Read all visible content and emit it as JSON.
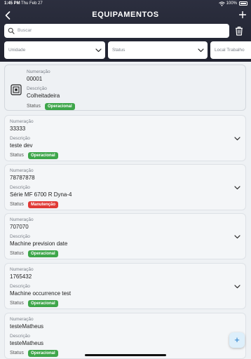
{
  "statusbar": {
    "time": "1:45 PM",
    "date": "Thu Feb 27",
    "battery": "100%"
  },
  "header": {
    "title": "EQUIPAMENTOS"
  },
  "search": {
    "placeholder": "Buscar"
  },
  "filters": {
    "unidade": "Unidade",
    "status": "Status",
    "local": "Local Trabalho"
  },
  "labels": {
    "numeracao": "Numeração",
    "descricao": "Descrição",
    "status": "Status"
  },
  "items": [
    {
      "numeracao": "00001",
      "descricao": "Colheitadeira",
      "status": "Operacional"
    },
    {
      "numeracao": "33333",
      "descricao": "teste dev",
      "status": "Operacional"
    },
    {
      "numeracao": "78787878",
      "descricao": "Série MF 6700 R Dyna-4",
      "status": "Manutenção"
    },
    {
      "numeracao": "707070",
      "descricao": "Machine prevision date",
      "status": "Operacional"
    },
    {
      "numeracao": "1765432",
      "descricao": "Machine occurrence test",
      "status": "Operacional"
    },
    {
      "numeracao": "testeMatheus",
      "descricao": "testeMatheus",
      "status": "Operacional"
    }
  ],
  "fab": {
    "label": "+"
  },
  "colors": {
    "header": "#2c2f3f",
    "operacional": "#3ea64a",
    "manutencao": "#e03a36",
    "accent": "#1976c9"
  }
}
